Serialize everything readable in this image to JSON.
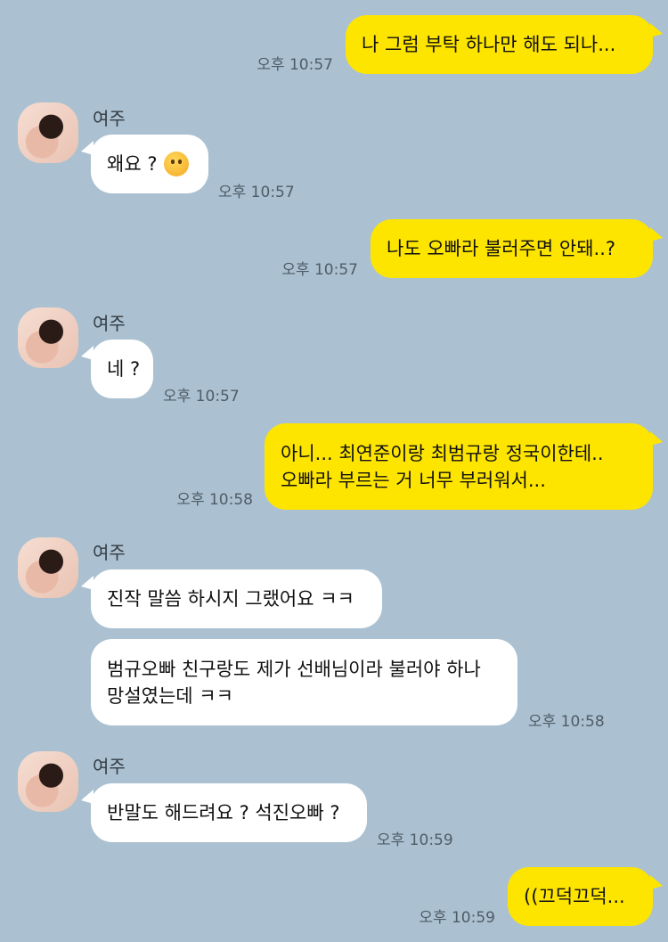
{
  "messages": [
    {
      "sender": "me",
      "text": "나 그럼 부탁 하나만 해도 되나...",
      "time": "오후 10:57"
    },
    {
      "sender": "them",
      "name": "여주",
      "text": "왜요 ?",
      "emoji": "thinking-face-icon",
      "time": "오후 10:57"
    },
    {
      "sender": "me",
      "text": "나도 오빠라 불러주면 안돼..?",
      "time": "오후 10:57"
    },
    {
      "sender": "them",
      "name": "여주",
      "text": "네 ?",
      "time": "오후 10:57"
    },
    {
      "sender": "me",
      "lines": [
        "아니... 최연준이랑 최범규랑 정국이한테..",
        "오빠라 부르는 거 너무 부러워서..."
      ],
      "time": "오후 10:58"
    },
    {
      "sender": "them",
      "name": "여주",
      "text": "진작 말씀 하시지 그랬어요 ㅋㅋ"
    },
    {
      "sender": "them",
      "lines": [
        "범규오빠 친구랑도 제가 선배님이라 불러야 하나",
        "망설였는데 ㅋㅋ"
      ],
      "time": "오후 10:58"
    },
    {
      "sender": "them",
      "name": "여주",
      "text": "반말도 해드려요 ? 석진오빠 ?",
      "time": "오후 10:59"
    },
    {
      "sender": "me",
      "text": "((끄덕끄덕...",
      "time": "오후 10:59"
    }
  ],
  "colors": {
    "background": "#abc1d1",
    "my_bubble": "#fee500",
    "their_bubble": "#ffffff"
  }
}
